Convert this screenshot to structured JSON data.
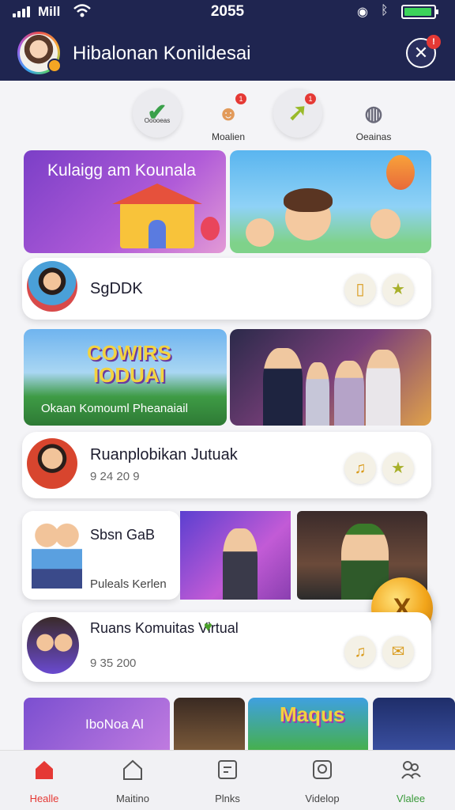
{
  "status_bar": {
    "carrier": "Mill",
    "time": "2055",
    "battery_level": 0.95
  },
  "header": {
    "title": "Hibalonan Konildesai"
  },
  "actions": [
    {
      "label": "Ooooeas",
      "icon": "checkmark-icon"
    },
    {
      "label": "Moalien",
      "icon": "character-icon"
    },
    {
      "label": "",
      "icon": "arrow-icon"
    },
    {
      "label": "Oeainas",
      "icon": "camera-icon"
    }
  ],
  "banners": {
    "b1_title": "Kulaigg am Kounala",
    "b3_title_line1": "COWIRS",
    "b3_title_line2": "IODUAI",
    "b3_subtitle": "Okaan Komouml Pheanaiail",
    "s1_text": "IboNoa Al",
    "s3_text": "Maqus"
  },
  "rows": [
    {
      "title": "SgDDK",
      "subtitle": ""
    },
    {
      "title": "Ruanplobikan Jutuak",
      "subtitle": "9 24 20 9"
    },
    {
      "title": "Ruans Komuitas Virtual",
      "subtitle": "9 35 200"
    }
  ],
  "card5": {
    "title": "Sbsn GaB",
    "subtitle": "Puleals Kerlen"
  },
  "bottom_nav": [
    {
      "label": "Healle"
    },
    {
      "label": "Maitino"
    },
    {
      "label": "Plnks"
    },
    {
      "label": "Videlop"
    },
    {
      "label": "Vlalee"
    }
  ],
  "colors": {
    "header_bg": "#1f2550",
    "accent_red": "#e53935",
    "accent_green": "#3a9a3a"
  }
}
